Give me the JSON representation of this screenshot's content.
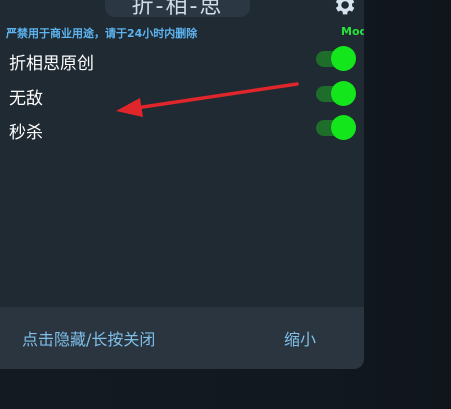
{
  "window": {
    "title": "折-相-思",
    "subtitle": "严禁用于商业用途，请于24小时内删除",
    "mod_label": "Mod"
  },
  "menu": {
    "items": [
      {
        "label": "折相思原创",
        "enabled": true
      },
      {
        "label": "无敌",
        "enabled": true
      },
      {
        "label": "秒杀",
        "enabled": true
      }
    ]
  },
  "footer": {
    "hide_close_label": "点击隐藏/长按关闭",
    "shrink_label": "缩小"
  },
  "icons": {
    "settings": "gear-icon",
    "annotation": "red-arrow"
  },
  "colors": {
    "panel_bg": "#202a33",
    "toggle_on": "#13e61b",
    "toggle_track": "#1f6d2b",
    "subtitle": "#5cb3ef",
    "mod_label": "#27e33a",
    "arrow": "#e0262a"
  }
}
